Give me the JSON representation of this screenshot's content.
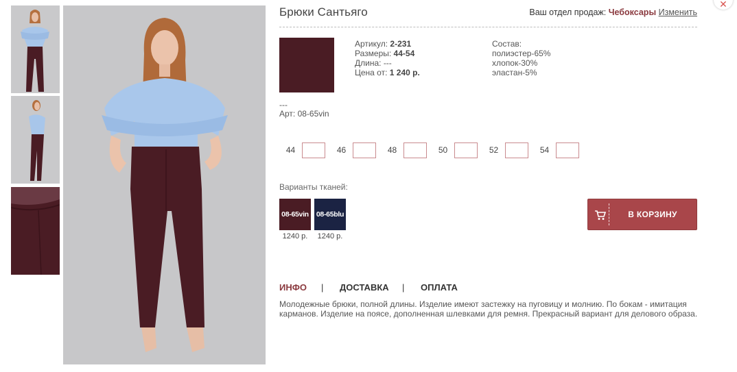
{
  "product": {
    "title": "Брюки Сантьяго",
    "color_hex": "#4a1c24"
  },
  "region": {
    "label": "Ваш отдел продаж:",
    "city": "Чебоксары",
    "change_link": "Изменить"
  },
  "specs": {
    "article_label": "Артикул:",
    "article_value": "2-231",
    "sizes_label": "Размеры:",
    "sizes_value": "44-54",
    "length_label": "Длина:",
    "length_value": "---",
    "price_label": "Цена от:",
    "price_value": "1 240 р."
  },
  "composition": {
    "label": "Состав:",
    "items": [
      "полиэстер-65%",
      "хлопок-30%",
      "эластан-5%"
    ]
  },
  "fabric_line": {
    "dash": "---",
    "art": "Арт: 08-65vin"
  },
  "sizes": [
    {
      "label": "44",
      "value": ""
    },
    {
      "label": "46",
      "value": ""
    },
    {
      "label": "48",
      "value": ""
    },
    {
      "label": "50",
      "value": ""
    },
    {
      "label": "52",
      "value": ""
    },
    {
      "label": "54",
      "value": ""
    }
  ],
  "variants": {
    "label": "Варианты тканей:",
    "items": [
      {
        "code": "08-65vin",
        "price": "1240 р.",
        "color": "#4a1c24"
      },
      {
        "code": "08-65blu",
        "price": "1240 р.",
        "color": "#1b2343"
      }
    ]
  },
  "cart": {
    "label": "В КОРЗИНУ",
    "icon": "cart-icon",
    "color": "#a9464a"
  },
  "tabs": {
    "info": "ИНФО",
    "separator": "|",
    "delivery": "ДОСТАВКА",
    "payment": "ОПЛАТА",
    "active_color": "#8b3a3f"
  },
  "description": "Молодежные брюки, полной длины. Изделие имеют застежку на пуговицу и молнию. По бокам - имитация карманов. Изделие на поясе, дополненная шлевками для ремня. Прекрасный вариант для делового образа.",
  "close_icon": "close-icon"
}
